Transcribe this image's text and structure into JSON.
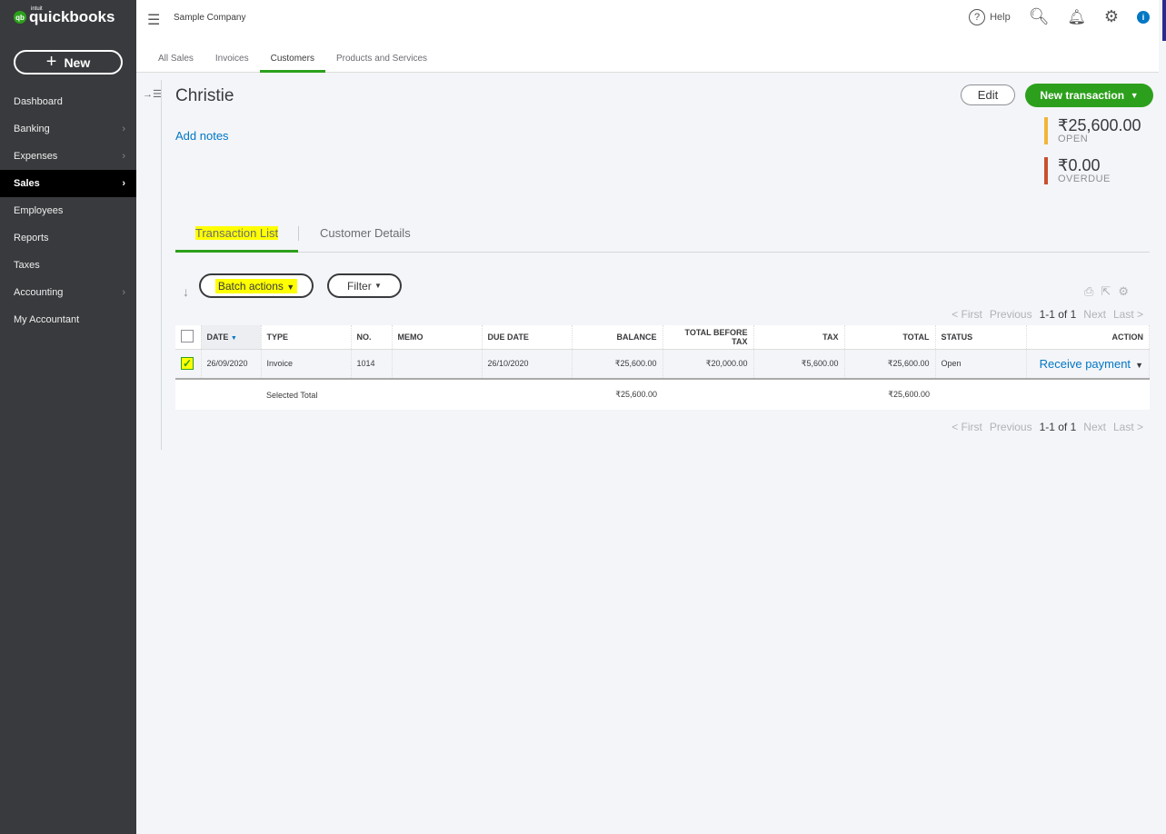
{
  "sidebar": {
    "logo": "quickbooks",
    "logo_small": "intuit",
    "new_label": "New",
    "items": [
      {
        "label": "Dashboard",
        "chev": false
      },
      {
        "label": "Banking",
        "chev": true
      },
      {
        "label": "Expenses",
        "chev": true
      },
      {
        "label": "Sales",
        "chev": true,
        "selected": true
      },
      {
        "label": "Employees",
        "chev": false
      },
      {
        "label": "Reports",
        "chev": false
      },
      {
        "label": "Taxes",
        "chev": false
      },
      {
        "label": "Accounting",
        "chev": true
      },
      {
        "label": "My Accountant",
        "chev": false
      }
    ]
  },
  "header": {
    "company": "Sample Company",
    "help": "Help",
    "tabs": [
      "All Sales",
      "Invoices",
      "Customers",
      "Products and Services"
    ],
    "active_tab": "Customers"
  },
  "customer": {
    "name": "Christie",
    "add_notes": "Add notes",
    "edit": "Edit",
    "new_transaction": "New transaction",
    "open_amount": "₹25,600.00",
    "open_label": "OPEN",
    "overdue_amount": "₹0.00",
    "overdue_label": "OVERDUE",
    "open_color": "#f2b53a",
    "overdue_color": "#c9502e"
  },
  "subtabs": [
    "Transaction List",
    "Customer Details"
  ],
  "toolbar": {
    "batch": "Batch actions",
    "filter": "Filter"
  },
  "pager": {
    "first": "< First",
    "previous": "Previous",
    "range": "1-1 of 1",
    "next": "Next",
    "last": "Last >"
  },
  "table": {
    "headers": [
      "DATE",
      "TYPE",
      "NO.",
      "MEMO",
      "DUE DATE",
      "BALANCE",
      "TOTAL BEFORE TAX",
      "TAX",
      "TOTAL",
      "STATUS",
      "ACTION"
    ],
    "rows": [
      {
        "date": "26/09/2020",
        "type": "Invoice",
        "no": "1014",
        "memo": "",
        "due": "26/10/2020",
        "balance": "₹25,600.00",
        "tbt": "₹20,000.00",
        "tax": "₹5,600.00",
        "total": "₹25,600.00",
        "status": "Open",
        "action": "Receive payment"
      }
    ],
    "footer": {
      "label": "Selected Total",
      "balance": "₹25,600.00",
      "total": "₹25,600.00"
    }
  }
}
